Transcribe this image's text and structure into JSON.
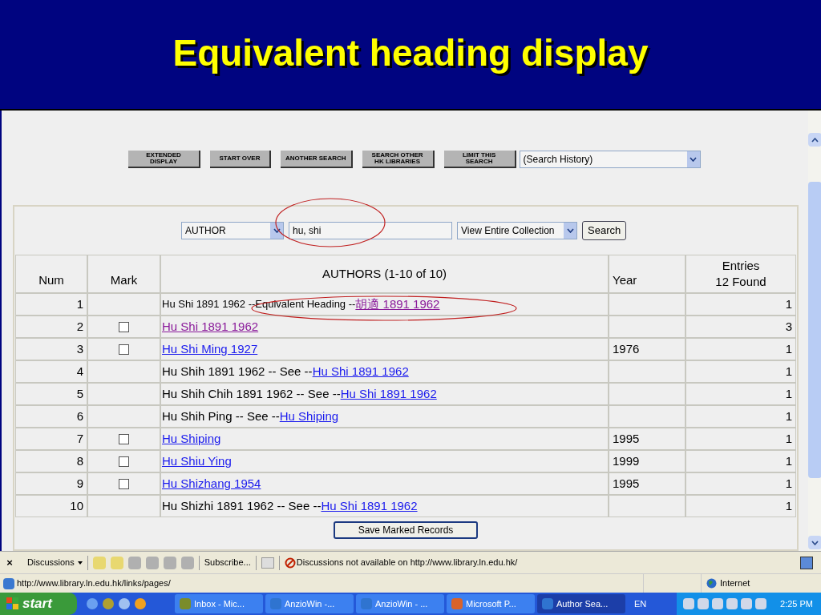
{
  "slide_title": "Equivalent heading display",
  "page_buttons": [
    "EXTENDED DISPLAY",
    "START OVER",
    "ANOTHER SEARCH",
    "SEARCH OTHER HK LIBRARIES",
    "LIMIT THIS SEARCH"
  ],
  "history_select": "(Search History)",
  "search": {
    "field_select": "AUTHOR",
    "value": "hu, shi",
    "scope_select": "View Entire Collection",
    "button": "Search"
  },
  "table": {
    "columns": [
      "Num",
      "Mark",
      "AUTHORS (1-10 of 10)",
      "Year",
      "Entries 12 Found"
    ],
    "rows": [
      {
        "num": "1",
        "text": "Hu Shi 1891 1962 --Equivalent Heading --",
        "link": "胡適 1891 1962",
        "visited": true,
        "year": "",
        "entries": "1"
      },
      {
        "num": "2",
        "mark": {
          "checked": false
        },
        "link": "Hu Shi 1891 1962",
        "visited": true,
        "year": "",
        "entries": "3"
      },
      {
        "num": "3",
        "mark": {
          "checked": false
        },
        "link": "Hu Shi Ming 1927",
        "visited": false,
        "year": "1976",
        "entries": "1"
      },
      {
        "num": "4",
        "text": "Hu Shih 1891 1962 -- See --",
        "link": "Hu Shi 1891 1962",
        "visited": false,
        "year": "",
        "entries": "1"
      },
      {
        "num": "5",
        "text": "Hu Shih Chih 1891 1962 -- See --",
        "link": "Hu Shi 1891 1962",
        "visited": false,
        "year": "",
        "entries": "1"
      },
      {
        "num": "6",
        "text": "Hu Shih Ping -- See --",
        "link": "Hu Shiping",
        "visited": false,
        "year": "",
        "entries": "1"
      },
      {
        "num": "7",
        "mark": {
          "checked": false
        },
        "link": "Hu Shiping",
        "visited": false,
        "year": "1995",
        "entries": "1"
      },
      {
        "num": "8",
        "mark": {
          "checked": false
        },
        "link": "Hu Shiu Ying",
        "visited": false,
        "year": "1999",
        "entries": "1"
      },
      {
        "num": "9",
        "mark": {
          "checked": false
        },
        "link": "Hu Shizhang 1954",
        "visited": false,
        "year": "1995",
        "entries": "1"
      },
      {
        "num": "10",
        "text": "Hu Shizhi 1891 1962 -- See --",
        "link": "Hu Shi 1891 1962",
        "visited": false,
        "year": "",
        "entries": "1"
      }
    ],
    "save_button": "Save Marked Records"
  },
  "discussions_bar": {
    "close": "×",
    "menu": "Discussions",
    "subscribe": "Subscribe...",
    "message": "Discussions not available on http://www.library.ln.edu.hk/"
  },
  "status_bar": {
    "url": "http://www.library.ln.edu.hk/links/pages/",
    "zone": "Internet"
  },
  "taskbar": {
    "start": "start",
    "tasks": [
      {
        "label": "Inbox - Mic...",
        "selected": false
      },
      {
        "label": "AnzioWin -...",
        "selected": false
      },
      {
        "label": "AnzioWin - ...",
        "selected": false
      },
      {
        "label": "Microsoft P...",
        "selected": false
      },
      {
        "label": "Author Sea...",
        "selected": true
      }
    ],
    "language": "EN",
    "clock": "2:25 PM"
  }
}
